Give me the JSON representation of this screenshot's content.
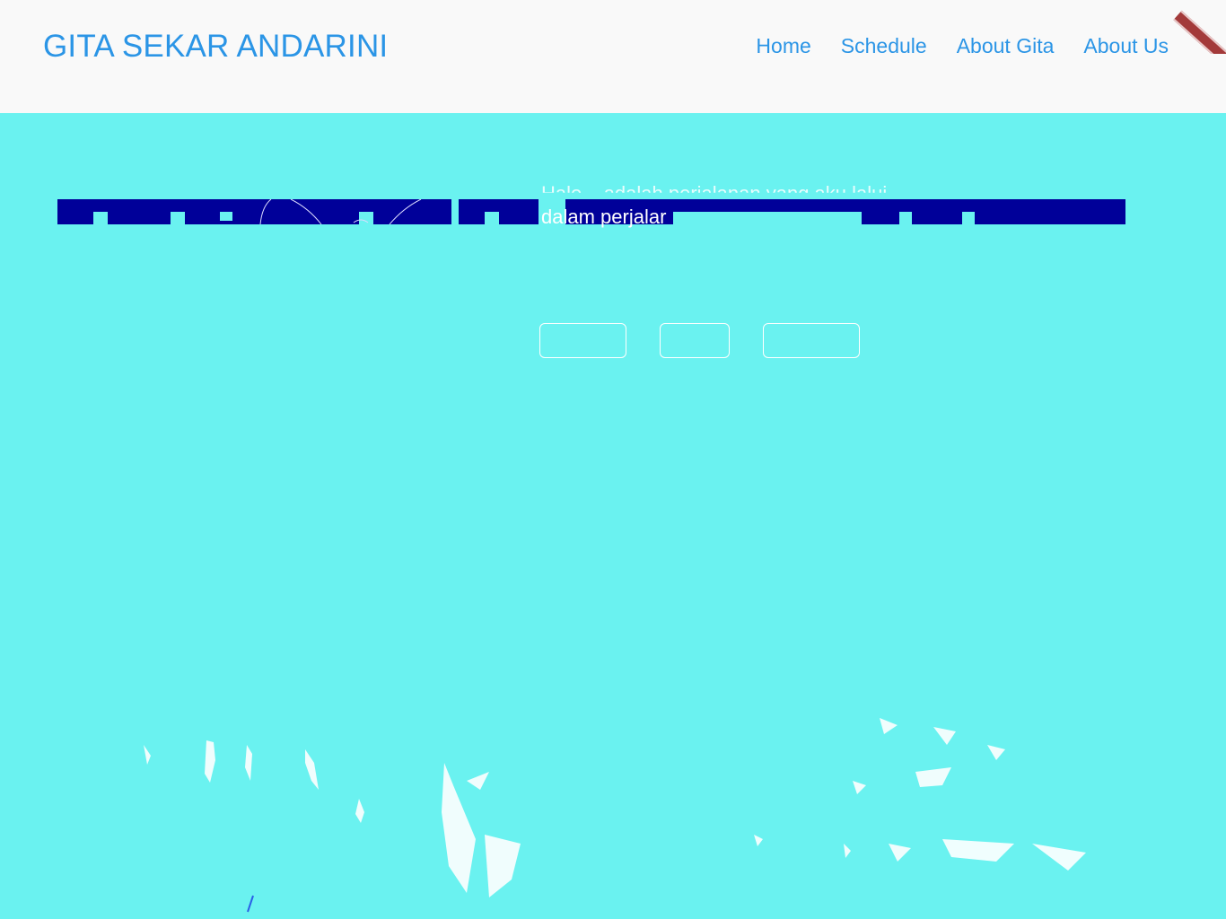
{
  "header": {
    "brand": "GITA SEKAR ANDARINI",
    "nav": [
      "Home",
      "Schedule",
      "About Gita",
      "About Us"
    ]
  },
  "hero": {
    "text_line1": "Halo... adalah perjalanan yang aku lalui...",
    "text_line2": "dalam perjalar",
    "buttons": [
      "",
      "",
      ""
    ]
  },
  "colors": {
    "background": "#6af2f0",
    "header_bg": "#f9f9f9",
    "accent": "#2b95e6",
    "strip": "#000099"
  }
}
